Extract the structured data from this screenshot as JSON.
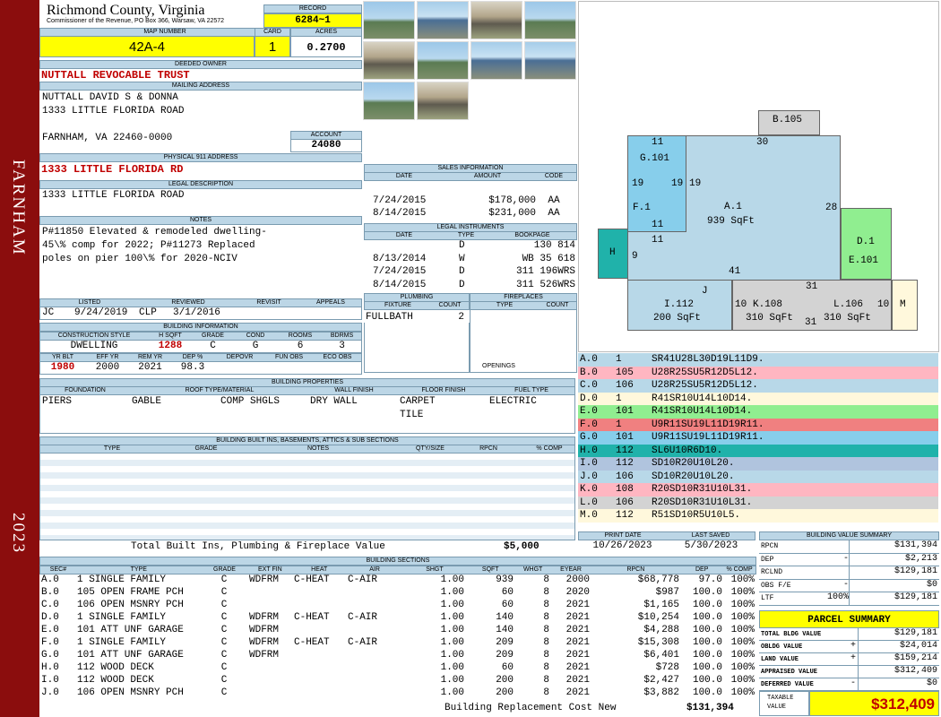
{
  "sidebar": {
    "town": "FARNHAM",
    "year": "2023"
  },
  "header": {
    "county": "Richmond County, Virginia",
    "commissioner": "Commissioner of the Revenue, PO Box 366, Warsaw, VA 22572",
    "record_label": "RECORD",
    "record": "6284~1",
    "map_label": "MAP NUMBER",
    "map": "42A-4",
    "card_label": "CARD",
    "card": "1",
    "acres_label": "ACRES",
    "acres": "0.2700"
  },
  "owner": {
    "deeded_label": "DEEDED OWNER",
    "deeded": "NUTTALL REVOCABLE TRUST",
    "mailing_label": "MAILING ADDRESS",
    "lines": [
      "NUTTALL DAVID S & DONNA",
      "1333 LITTLE FLORIDA ROAD",
      "",
      "FARNHAM, VA 22460-0000"
    ],
    "account_label": "ACCOUNT",
    "account": "24080",
    "physical_label": "PHYSICAL 911 ADDRESS",
    "physical": "1333 LITTLE FLORIDA RD",
    "legal_label": "LEGAL DESCRIPTION",
    "legal": "1333 LITTLE FLORIDA ROAD"
  },
  "notes": {
    "label": "NOTES",
    "lines": [
      "P#11850 Elevated & remodeled dwelling-",
      "45\\% comp for 2022; P#11273 Replaced",
      "poles on pier 100\\% for 2020-NCIV"
    ]
  },
  "sales": {
    "label": "SALES INFORMATION",
    "headers": [
      "DATE",
      "AMOUNT",
      "CODE"
    ],
    "rows": [
      [
        "7/24/2015",
        "$178,000",
        "AA"
      ],
      [
        "8/14/2015",
        "$231,000",
        "AA"
      ]
    ]
  },
  "legal_instruments": {
    "label": "LEGAL INSTRUMENTS",
    "headers": [
      "DATE",
      "TYPE",
      "BOOKPAGE"
    ],
    "rows": [
      [
        "",
        "D",
        "130 814"
      ],
      [
        "8/13/2014",
        "W",
        "WB 35 618"
      ],
      [
        "7/24/2015",
        "D",
        "311 196WRS"
      ],
      [
        "8/14/2015",
        "D",
        "311 526WRS"
      ]
    ]
  },
  "listed": {
    "headers": [
      "LISTED",
      "REVIEWED",
      "REVISIT",
      "APPEALS"
    ],
    "values": [
      "JC",
      "9/24/2019",
      "CLP",
      "3/1/2016",
      "",
      ""
    ]
  },
  "building_info": {
    "label": "BUILDING INFORMATION",
    "headers1": [
      "CONSTRUCTION STYLE",
      "H SQFT",
      "GRADE",
      "COND",
      "ROOMS",
      "BDRMS"
    ],
    "values1": [
      "DWELLING",
      "1288",
      "C",
      "G",
      "6",
      "3"
    ],
    "headers2": [
      "YR BLT",
      "EFF YR",
      "REM YR",
      "DEP %",
      "DEPOVR",
      "FUN OBS",
      "ECO OBS"
    ],
    "values2": [
      "1980",
      "2000",
      "2021",
      "98.3",
      "",
      "",
      ""
    ]
  },
  "plumbing": {
    "label": "PLUMBING",
    "headers": [
      "FIXTURE",
      "COUNT"
    ],
    "rows": [
      [
        "FULLBATH",
        "2"
      ]
    ]
  },
  "fireplaces": {
    "label": "FIREPLACES",
    "headers": [
      "TYPE",
      "COUNT"
    ],
    "openings_label": "OPENINGS"
  },
  "properties": {
    "label": "BUILDING PROPERTIES",
    "headers": [
      "FOUNDATION",
      "ROOF TYPE/MATERIAL",
      "WALL FINISH",
      "FLOOR FINISH",
      "FUEL TYPE"
    ],
    "foundation": "PIERS",
    "roof_type": "GABLE",
    "roof_material": "COMP SHGLS",
    "wall": "DRY WALL",
    "floor": [
      "CARPET",
      "TILE"
    ],
    "fuel": "ELECTRIC"
  },
  "builtins": {
    "label": "BUILDING BUILT INS, BASEMENTS, ATTICS & SUB SECTIONS",
    "headers": [
      "TYPE",
      "GRADE",
      "NOTES",
      "QTY/SIZE",
      "RPCN",
      "% COMP"
    ],
    "total_label": "Total Built Ins, Plumbing & Fireplace Value",
    "total": "$5,000"
  },
  "sketch": {
    "B": [
      "B.105",
      "30"
    ],
    "G": [
      "11",
      "G.101",
      "19",
      "19",
      "19",
      "F.1",
      "11",
      "11"
    ],
    "A": [
      "A.1",
      "939 SqFt",
      "28",
      "41"
    ],
    "H": [
      "H",
      "9"
    ],
    "D": [
      "D.1",
      "E.101"
    ],
    "I": [
      "J",
      "I.112",
      "200 SqFt"
    ],
    "K": [
      "31",
      "10",
      "K.108",
      "310 SqFt",
      "31"
    ],
    "L": [
      "L.106",
      "310 SqFt",
      "10"
    ],
    "M": "M"
  },
  "segments": [
    {
      "id": "A.0",
      "code": "1",
      "desc": "SR41U28L30D19L11D9.",
      "color": "#b8d8e8"
    },
    {
      "id": "B.0",
      "code": "105",
      "desc": "U28R25SU5R12D5L12.",
      "color": "#ffb6c1"
    },
    {
      "id": "C.0",
      "code": "106",
      "desc": "U28R25SU5R12D5L12.",
      "color": "#b8d8e8"
    },
    {
      "id": "D.0",
      "code": "1",
      "desc": "R41SR10U14L10D14.",
      "color": "#fff8dc"
    },
    {
      "id": "E.0",
      "code": "101",
      "desc": "R41SR10U14L10D14.",
      "color": "#90ee90"
    },
    {
      "id": "F.0",
      "code": "1",
      "desc": "U9R11SU19L11D19R11.",
      "color": "#f08080"
    },
    {
      "id": "G.0",
      "code": "101",
      "desc": "U9R11SU19L11D19R11.",
      "color": "#87ceeb"
    },
    {
      "id": "H.0",
      "code": "112",
      "desc": "SL6U10R6D10.",
      "color": "#20b2aa"
    },
    {
      "id": "I.0",
      "code": "112",
      "desc": "SD10R20U10L20.",
      "color": "#b0c4de"
    },
    {
      "id": "J.0",
      "code": "106",
      "desc": "SD10R20U10L20.",
      "color": "#b8d8e8"
    },
    {
      "id": "K.0",
      "code": "108",
      "desc": "R20SD10R31U10L31.",
      "color": "#ffb6c1"
    },
    {
      "id": "L.0",
      "code": "106",
      "desc": "R20SD10R31U10L31.",
      "color": "#d3d3d3"
    },
    {
      "id": "M.0",
      "code": "112",
      "desc": "R51SD10R5U10L5.",
      "color": "#fff8dc"
    }
  ],
  "print": {
    "headers": [
      "PRINT DATE",
      "LAST SAVED"
    ],
    "values": [
      "10/26/2023",
      "5/30/2023"
    ]
  },
  "value_summary": {
    "label": "BUILDING VALUE SUMMARY",
    "rows": [
      [
        "RPCN",
        "",
        "$131,394"
      ],
      [
        "DEP",
        "-",
        "$2,213"
      ],
      [
        "RCLND",
        "",
        "$129,181"
      ],
      [
        "OBS F/E",
        "-",
        "$0"
      ],
      [
        "LTF",
        "100%",
        "$129,181"
      ]
    ]
  },
  "parcel": {
    "label": "PARCEL SUMMARY",
    "rows": [
      [
        "TOTAL BLDG VALUE",
        "",
        "$129,181"
      ],
      [
        "OBLDG VALUE",
        "+",
        "$24,014"
      ],
      [
        "LAND VALUE",
        "+",
        "$159,214"
      ],
      [
        "APPRAISED VALUE",
        "",
        "$312,409"
      ],
      [
        "DEFERRED VALUE",
        "-",
        "$0"
      ]
    ],
    "taxable_label": "TAXABLE VALUE",
    "taxable": "$312,409"
  },
  "sections": {
    "label": "BUILDING SECTIONS",
    "headers": [
      "SEC#",
      "TYPE",
      "GRADE",
      "EXT FIN",
      "HEAT",
      "AIR",
      "SHGT",
      "SQFT",
      "WHGT",
      "EYEAR",
      "RPCN",
      "DEP",
      "% COMP"
    ],
    "rows": [
      [
        "A.0",
        "1 SINGLE FAMILY",
        "C",
        "WDFRM",
        "C-HEAT",
        "C-AIR",
        "1.00",
        "939",
        "8",
        "2000",
        "$68,778",
        "97.0",
        "100%"
      ],
      [
        "B.0",
        "105 OPEN FRAME PCH",
        "C",
        "",
        "",
        "",
        "1.00",
        "60",
        "8",
        "2020",
        "$987",
        "100.0",
        "100%"
      ],
      [
        "C.0",
        "106 OPEN MSNRY PCH",
        "C",
        "",
        "",
        "",
        "1.00",
        "60",
        "8",
        "2021",
        "$1,165",
        "100.0",
        "100%"
      ],
      [
        "D.0",
        "1 SINGLE FAMILY",
        "C",
        "WDFRM",
        "C-HEAT",
        "C-AIR",
        "1.00",
        "140",
        "8",
        "2021",
        "$10,254",
        "100.0",
        "100%"
      ],
      [
        "E.0",
        "101 ATT UNF GARAGE",
        "C",
        "WDFRM",
        "",
        "",
        "1.00",
        "140",
        "8",
        "2021",
        "$4,288",
        "100.0",
        "100%"
      ],
      [
        "F.0",
        "1 SINGLE FAMILY",
        "C",
        "WDFRM",
        "C-HEAT",
        "C-AIR",
        "1.00",
        "209",
        "8",
        "2021",
        "$15,308",
        "100.0",
        "100%"
      ],
      [
        "G.0",
        "101 ATT UNF GARAGE",
        "C",
        "WDFRM",
        "",
        "",
        "1.00",
        "209",
        "8",
        "2021",
        "$6,401",
        "100.0",
        "100%"
      ],
      [
        "H.0",
        "112 WOOD DECK",
        "C",
        "",
        "",
        "",
        "1.00",
        "60",
        "8",
        "2021",
        "$728",
        "100.0",
        "100%"
      ],
      [
        "I.0",
        "112 WOOD DECK",
        "C",
        "",
        "",
        "",
        "1.00",
        "200",
        "8",
        "2021",
        "$2,427",
        "100.0",
        "100%"
      ],
      [
        "J.0",
        "106 OPEN MSNRY PCH",
        "C",
        "",
        "",
        "",
        "1.00",
        "200",
        "8",
        "2021",
        "$3,882",
        "100.0",
        "100%"
      ]
    ],
    "total_label": "Building Replacement Cost New",
    "total": "$131,394"
  }
}
